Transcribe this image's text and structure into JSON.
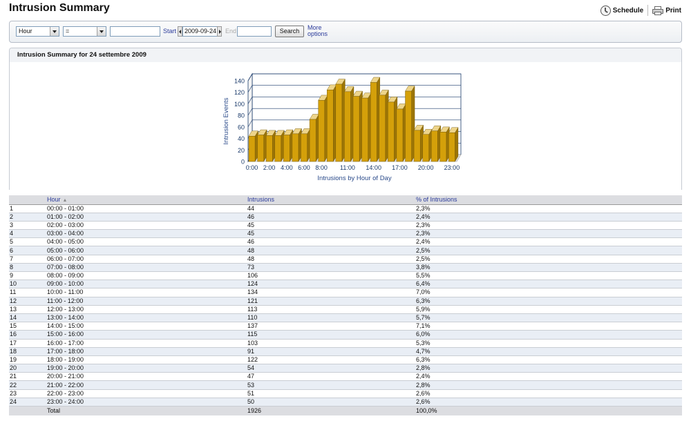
{
  "header": {
    "title": "Intrusion Summary",
    "schedule_label": "Schedule",
    "print_label": "Print"
  },
  "filter": {
    "field_select": "Hour",
    "operator_select": "=",
    "value_input": "",
    "start_label": "Start",
    "start_date": "2009-09-24",
    "end_label": "End",
    "end_input": "",
    "search_label": "Search",
    "more_line1": "More",
    "more_line2": "options"
  },
  "panel": {
    "title": "Intrusion Summary for 24 settembre 2009"
  },
  "colors": {
    "bar_front": "#d4a00a",
    "bar_top": "#edd48a",
    "bar_side": "#9c7506",
    "grid": "#1a3a6a"
  },
  "chart_data": {
    "type": "bar",
    "xlabel": "Intrusions by Hour of Day",
    "ylabel": "Intrusion Events",
    "ylim": [
      0,
      140
    ],
    "yticks": [
      0,
      20,
      40,
      60,
      80,
      100,
      120,
      140
    ],
    "x_tick_labels": [
      "0:00",
      "2:00",
      "4:00",
      "6:00",
      "8:00",
      "11:00",
      "14:00",
      "17:00",
      "20:00",
      "23:00"
    ],
    "x_tick_hours": [
      0,
      2,
      4,
      6,
      8,
      11,
      14,
      17,
      20,
      23
    ],
    "values": [
      44,
      46,
      45,
      45,
      46,
      48,
      48,
      73,
      106,
      124,
      134,
      121,
      113,
      110,
      137,
      115,
      103,
      91,
      122,
      54,
      47,
      53,
      51,
      50
    ],
    "grid": true,
    "legend": "none"
  },
  "table": {
    "headers": {
      "hour": "Hour",
      "intrusions": "Intrusions",
      "pct": "% of Intrusions"
    },
    "rows": [
      {
        "n": "1",
        "hour": "00:00 - 01:00",
        "intrusions": "44",
        "pct": "2,3%"
      },
      {
        "n": "2",
        "hour": "01:00 - 02:00",
        "intrusions": "46",
        "pct": "2,4%"
      },
      {
        "n": "3",
        "hour": "02:00 - 03:00",
        "intrusions": "45",
        "pct": "2,3%"
      },
      {
        "n": "4",
        "hour": "03:00 - 04:00",
        "intrusions": "45",
        "pct": "2,3%"
      },
      {
        "n": "5",
        "hour": "04:00 - 05:00",
        "intrusions": "46",
        "pct": "2,4%"
      },
      {
        "n": "6",
        "hour": "05:00 - 06:00",
        "intrusions": "48",
        "pct": "2,5%"
      },
      {
        "n": "7",
        "hour": "06:00 - 07:00",
        "intrusions": "48",
        "pct": "2,5%"
      },
      {
        "n": "8",
        "hour": "07:00 - 08:00",
        "intrusions": "73",
        "pct": "3,8%"
      },
      {
        "n": "9",
        "hour": "08:00 - 09:00",
        "intrusions": "106",
        "pct": "5,5%"
      },
      {
        "n": "10",
        "hour": "09:00 - 10:00",
        "intrusions": "124",
        "pct": "6,4%"
      },
      {
        "n": "11",
        "hour": "10:00 - 11:00",
        "intrusions": "134",
        "pct": "7,0%"
      },
      {
        "n": "12",
        "hour": "11:00 - 12:00",
        "intrusions": "121",
        "pct": "6,3%"
      },
      {
        "n": "13",
        "hour": "12:00 - 13:00",
        "intrusions": "113",
        "pct": "5,9%"
      },
      {
        "n": "14",
        "hour": "13:00 - 14:00",
        "intrusions": "110",
        "pct": "5,7%"
      },
      {
        "n": "15",
        "hour": "14:00 - 15:00",
        "intrusions": "137",
        "pct": "7,1%"
      },
      {
        "n": "16",
        "hour": "15:00 - 16:00",
        "intrusions": "115",
        "pct": "6,0%"
      },
      {
        "n": "17",
        "hour": "16:00 - 17:00",
        "intrusions": "103",
        "pct": "5,3%"
      },
      {
        "n": "18",
        "hour": "17:00 - 18:00",
        "intrusions": "91",
        "pct": "4,7%"
      },
      {
        "n": "19",
        "hour": "18:00 - 19:00",
        "intrusions": "122",
        "pct": "6,3%"
      },
      {
        "n": "20",
        "hour": "19:00 - 20:00",
        "intrusions": "54",
        "pct": "2,8%"
      },
      {
        "n": "21",
        "hour": "20:00 - 21:00",
        "intrusions": "47",
        "pct": "2,4%"
      },
      {
        "n": "22",
        "hour": "21:00 - 22:00",
        "intrusions": "53",
        "pct": "2,8%"
      },
      {
        "n": "23",
        "hour": "22:00 - 23:00",
        "intrusions": "51",
        "pct": "2,6%"
      },
      {
        "n": "24",
        "hour": "23:00 - 24:00",
        "intrusions": "50",
        "pct": "2,6%"
      }
    ],
    "total": {
      "label": "Total",
      "intrusions": "1926",
      "pct": "100,0%"
    }
  }
}
